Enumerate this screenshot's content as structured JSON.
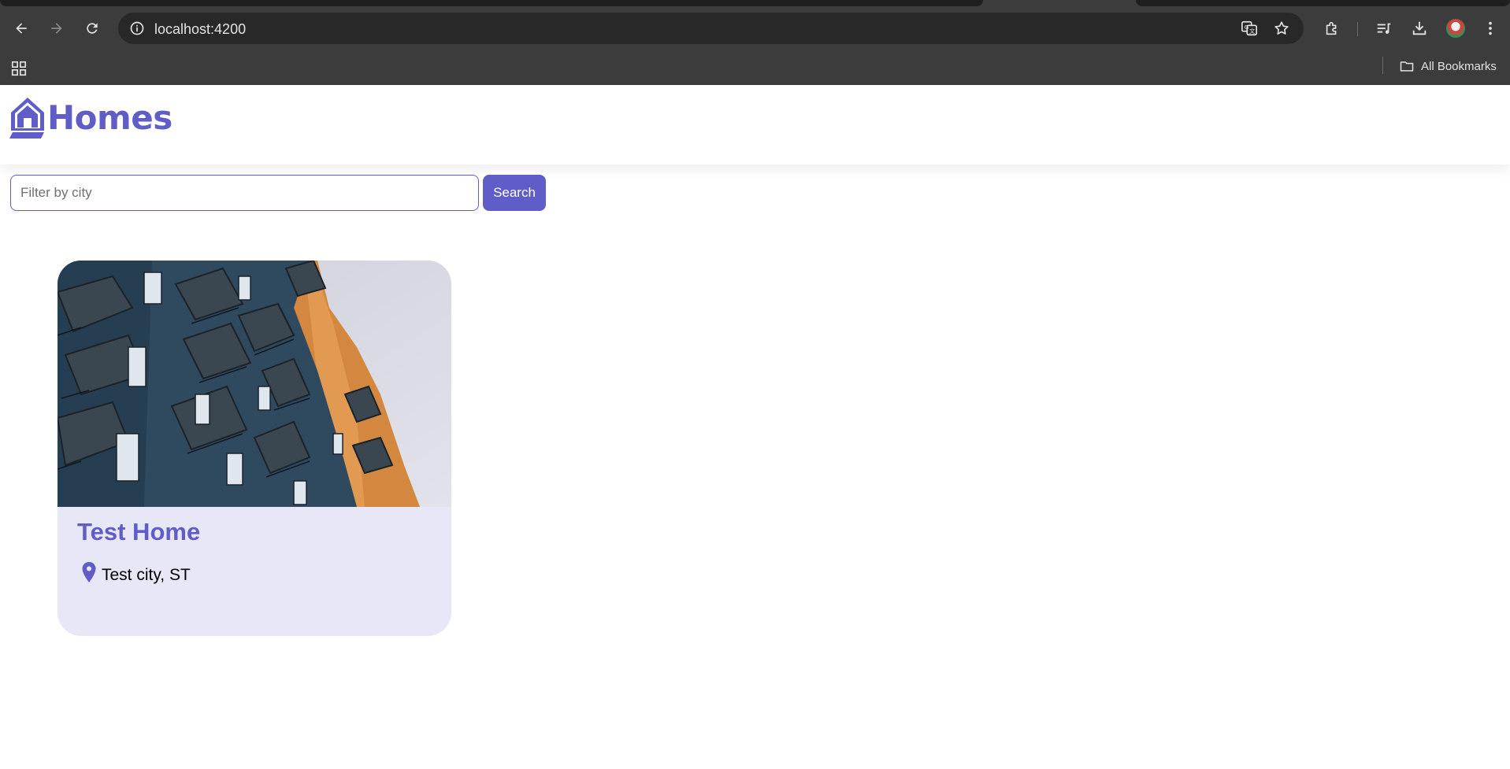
{
  "browser": {
    "url": "localhost:4200",
    "bookmarks_folder_label": "All Bookmarks"
  },
  "app": {
    "brand_name": "Homes",
    "accent_color": "#605dc8"
  },
  "search": {
    "placeholder": "Filter by city",
    "value": "",
    "button_label": "Search"
  },
  "listings": [
    {
      "name": "Test Home",
      "location": "Test city, ST",
      "photo_icon": "apartment-building-photo"
    }
  ]
}
